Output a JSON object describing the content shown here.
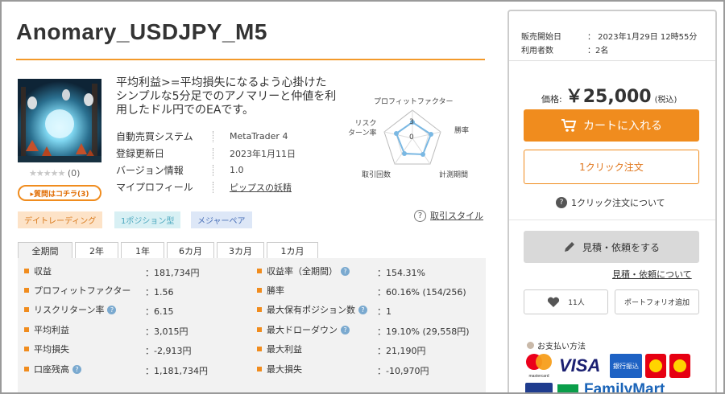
{
  "product": {
    "title": "Anomary_USDJPY_M5",
    "description": "平均利益>=平均損失になるよう心掛けたシンプルな5分足でのアノマリーと仲値を利用したドル円でのEAです。",
    "rating_stars": "★★★★★",
    "rating_count": "(0)",
    "qa_button": "▸質問はコチラ(3)"
  },
  "spec": [
    {
      "label": "自動売買システム",
      "value": "MetaTrader 4"
    },
    {
      "label": "登録更新日",
      "value": "2023年1月11日"
    },
    {
      "label": "バージョン情報",
      "value": "1.0"
    },
    {
      "label": "マイプロフィール",
      "value": "ピップスの妖精"
    }
  ],
  "radar": {
    "labels": {
      "top": "プロフィットファクター",
      "right_top": "勝率",
      "right_bottom": "計測期間",
      "left_bottom": "取引回数",
      "left_top": "リスク\nターン率"
    },
    "center_values": [
      "3",
      "0"
    ]
  },
  "tags": [
    "デイトレーディング",
    "1ポジション型",
    "メジャーペア"
  ],
  "trade_style_link": "取引スタイル",
  "period_tabs": [
    "全期間",
    "2年",
    "1年",
    "6カ月",
    "3カ月",
    "1カ月"
  ],
  "stats_left": [
    {
      "label": "収益",
      "value": "：181,734円",
      "help": false
    },
    {
      "label": "プロフィットファクター",
      "value": "：1.56",
      "help": false
    },
    {
      "label": "リスクリターン率",
      "value": "：6.15",
      "help": true
    },
    {
      "label": "平均利益",
      "value": "：3,015円",
      "help": false
    },
    {
      "label": "平均損失",
      "value": "：-2,913円",
      "help": false
    },
    {
      "label": "口座残高",
      "value": "：1,181,734円",
      "help": true
    }
  ],
  "stats_right": [
    {
      "label": "収益率（全期間）",
      "value": "：154.31%",
      "help": true
    },
    {
      "label": "勝率",
      "value": "：60.16% (154/256)",
      "help": false
    },
    {
      "label": "最大保有ポジション数",
      "value": "：1",
      "help": true
    },
    {
      "label": "最大ドローダウン",
      "value": "：19.10% (29,558円)",
      "help": true
    },
    {
      "label": "最大利益",
      "value": "：21,190円",
      "help": false
    },
    {
      "label": "最大損失",
      "value": "：-10,970円",
      "help": false
    }
  ],
  "sidebar": {
    "sale_start_label": "販売開始日",
    "sale_start_value": "：  2023年1月29日 12時55分",
    "users_label": "利用者数",
    "users_value": "：2名",
    "price_label": "価格:",
    "price_value": "￥25,000",
    "price_tax": "(税込)",
    "cart_button": "カートに入れる",
    "oneclick_button": "1クリック注文",
    "oneclick_help": "1クリック注文について",
    "estimate_button": "見積・依頼をする",
    "estimate_link": "見積・依頼について",
    "favorite_count": "11人",
    "portfolio_button": "ポートフォリオ追加",
    "payment_title": "お支払い方法",
    "payment_methods": [
      "mastercard",
      "VISA",
      "銀行振込",
      "FamilyMart"
    ]
  },
  "colors": {
    "accent": "#f08c1e",
    "help_icon": "#7aa9cf",
    "radar_line": "#7ab8e3"
  }
}
